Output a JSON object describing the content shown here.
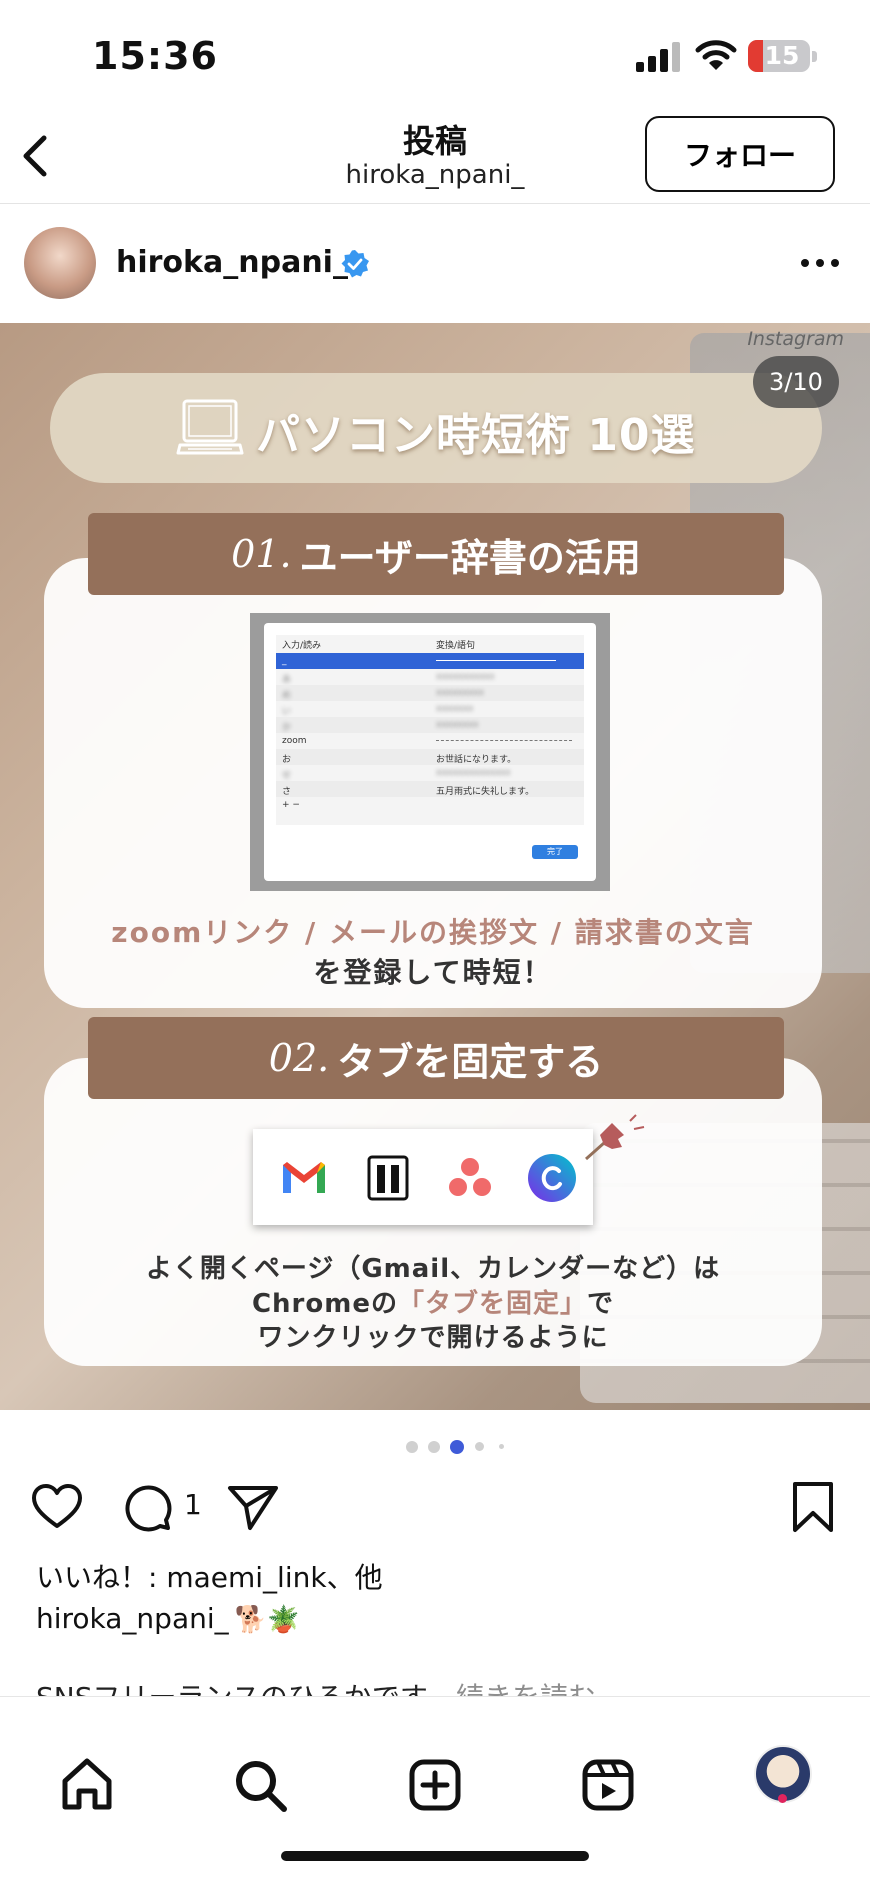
{
  "status_bar": {
    "time": "15:36",
    "battery": "15"
  },
  "nav": {
    "title": "投稿",
    "subtitle": "hiroka_npani_",
    "follow_label": "フォロー"
  },
  "post": {
    "username": "hiroka_npani_",
    "counter": "3/10",
    "slide": {
      "watermark": "Instagram",
      "title": "パソコン時短術 10選",
      "section1": {
        "num": "01.",
        "title": "ユーザー辞書の活用"
      },
      "dict": {
        "header_input": "入力/読み",
        "header_convert": "変換/語句",
        "rows": [
          {
            "k": "_",
            "v": ""
          },
          {
            "k": "zoom",
            "v": ""
          },
          {
            "k": "お",
            "v": "お世話になります。"
          },
          {
            "k": "さ",
            "v": "五月雨式に失礼します。"
          }
        ],
        "done_label": "完了",
        "add_remove": "+  −"
      },
      "desc1_line1": "zoomリンク / メールの挨拶文 / 請求書の文言",
      "desc1_line2": "を登録して時短！",
      "section2": {
        "num": "02.",
        "title": "タブを固定する"
      },
      "desc2_line1": "よく開くページ（Gmail、カレンダーなど）は",
      "desc2_line2_pre": "Chromeの",
      "desc2_line2_hl": "「タブを固定」",
      "desc2_line2_post": "で",
      "desc2_line3": "ワンクリックで開けるように"
    },
    "carousel_dots": 5,
    "active_dot": 2,
    "comment_count": "1",
    "likes_text": "いいね！: maemi_link、他",
    "caption_user": "hiroka_npani_",
    "caption_emoji": "🐕🪴",
    "caption_text": "SNSフリーランスのひろかです",
    "caption_more": "…続きを読む"
  },
  "tabbar": {
    "icons": [
      "home-icon",
      "search-icon",
      "create-icon",
      "reels-icon",
      "profile-icon"
    ]
  },
  "colors": {
    "brown": "#94705a",
    "pink_text": "#b7867a",
    "accent_blue": "#3897f0"
  }
}
